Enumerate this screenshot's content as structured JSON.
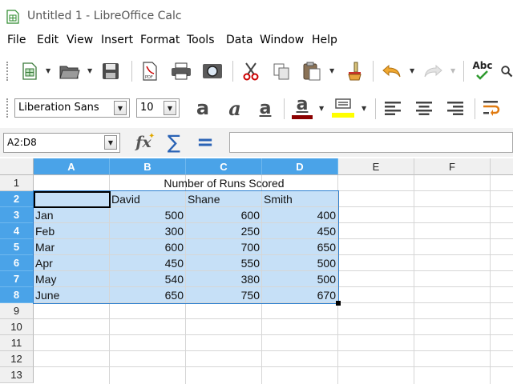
{
  "window": {
    "title": "Untitled 1 - LibreOffice Calc"
  },
  "menu": [
    "File",
    "Edit",
    "View",
    "Insert",
    "Format",
    "Tools",
    "Data",
    "Window",
    "Help"
  ],
  "toolbar_standard": [
    "new-icon",
    "open-icon",
    "save-icon",
    "export-pdf-icon",
    "print-icon",
    "print-preview-icon",
    "cut-icon",
    "copy-icon",
    "paste-icon",
    "clone-formatting-icon",
    "undo-icon",
    "redo-icon",
    "spelling-icon",
    "find-icon"
  ],
  "spelling_label": "Abc",
  "formatting": {
    "font_name": "Liberation Sans",
    "font_size": "10",
    "bold_glyph": "a",
    "italic_glyph": "a",
    "underline_glyph": "a",
    "font_color_glyph": "a",
    "font_color": "#8b0000",
    "highlight_color": "#ffff00"
  },
  "formula_bar": {
    "name_box": "A2:D8",
    "function_wizard": "fx",
    "sum_glyph": "∑",
    "equals_glyph": "=",
    "input": ""
  },
  "sheet": {
    "columns": [
      "A",
      "B",
      "C",
      "D",
      "E",
      "F"
    ],
    "rows": [
      "1",
      "2",
      "3",
      "4",
      "5",
      "6",
      "7",
      "8",
      "9",
      "10",
      "11",
      "12",
      "13"
    ],
    "selection": "A2:D8",
    "title": "Number of Runs Scored",
    "header": [
      "David",
      "Shane",
      "Smith"
    ],
    "data": [
      [
        "Jan",
        "500",
        "600",
        "400"
      ],
      [
        "Feb",
        "300",
        "250",
        "450"
      ],
      [
        "Mar",
        "600",
        "700",
        "650"
      ],
      [
        "Apr",
        "450",
        "550",
        "500"
      ],
      [
        "May",
        "540",
        "380",
        "500"
      ],
      [
        "June",
        "650",
        "750",
        "670"
      ]
    ]
  }
}
